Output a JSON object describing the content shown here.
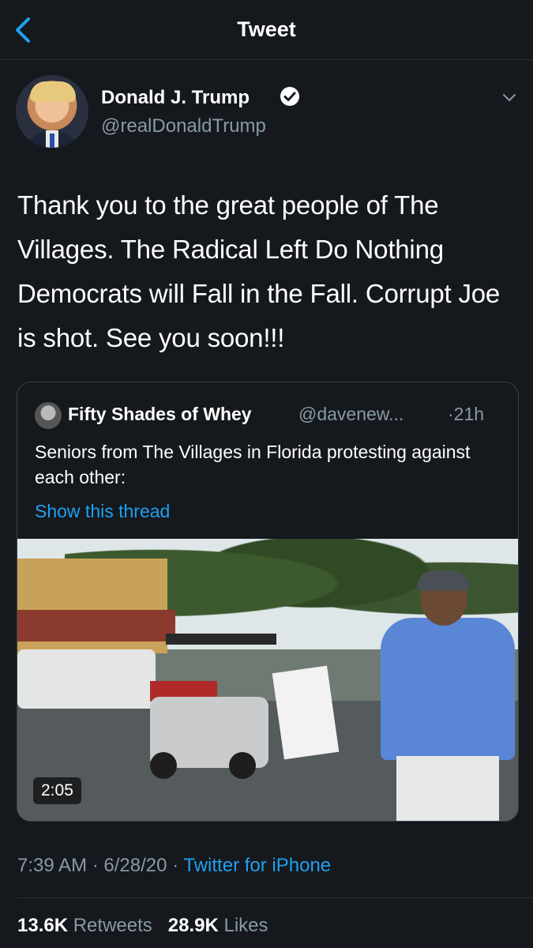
{
  "header": {
    "title": "Tweet",
    "back_icon": "chevron-left-icon"
  },
  "tweet": {
    "author_name": "Donald J. Trump",
    "author_handle": "@realDonaldTrump",
    "verified_icon": "verified-badge-icon",
    "menu_icon": "chevron-down-icon",
    "text": "Thank you to the great people of The Villages. The Radical Left Do Nothing Democrats will Fall in the Fall. Corrupt Joe is shot. See you soon!!!",
    "time": "7:39 AM",
    "separator": "·",
    "date": "6/28/20",
    "source": "Twitter for iPhone",
    "retweets_count": "13.6K",
    "retweets_label": "Retweets",
    "likes_count": "28.9K",
    "likes_label": "Likes"
  },
  "quote": {
    "author_name": "Fifty Shades of Whey",
    "author_handle": "@davenew...",
    "time": "·21h",
    "text": "Seniors from The Villages in Florida protesting against each other:",
    "thread_link": "Show this thread",
    "video_duration": "2:05"
  },
  "colors": {
    "background": "#15181c",
    "accent": "#1da1f2",
    "secondary_text": "#8899a6",
    "border": "#38444d"
  }
}
